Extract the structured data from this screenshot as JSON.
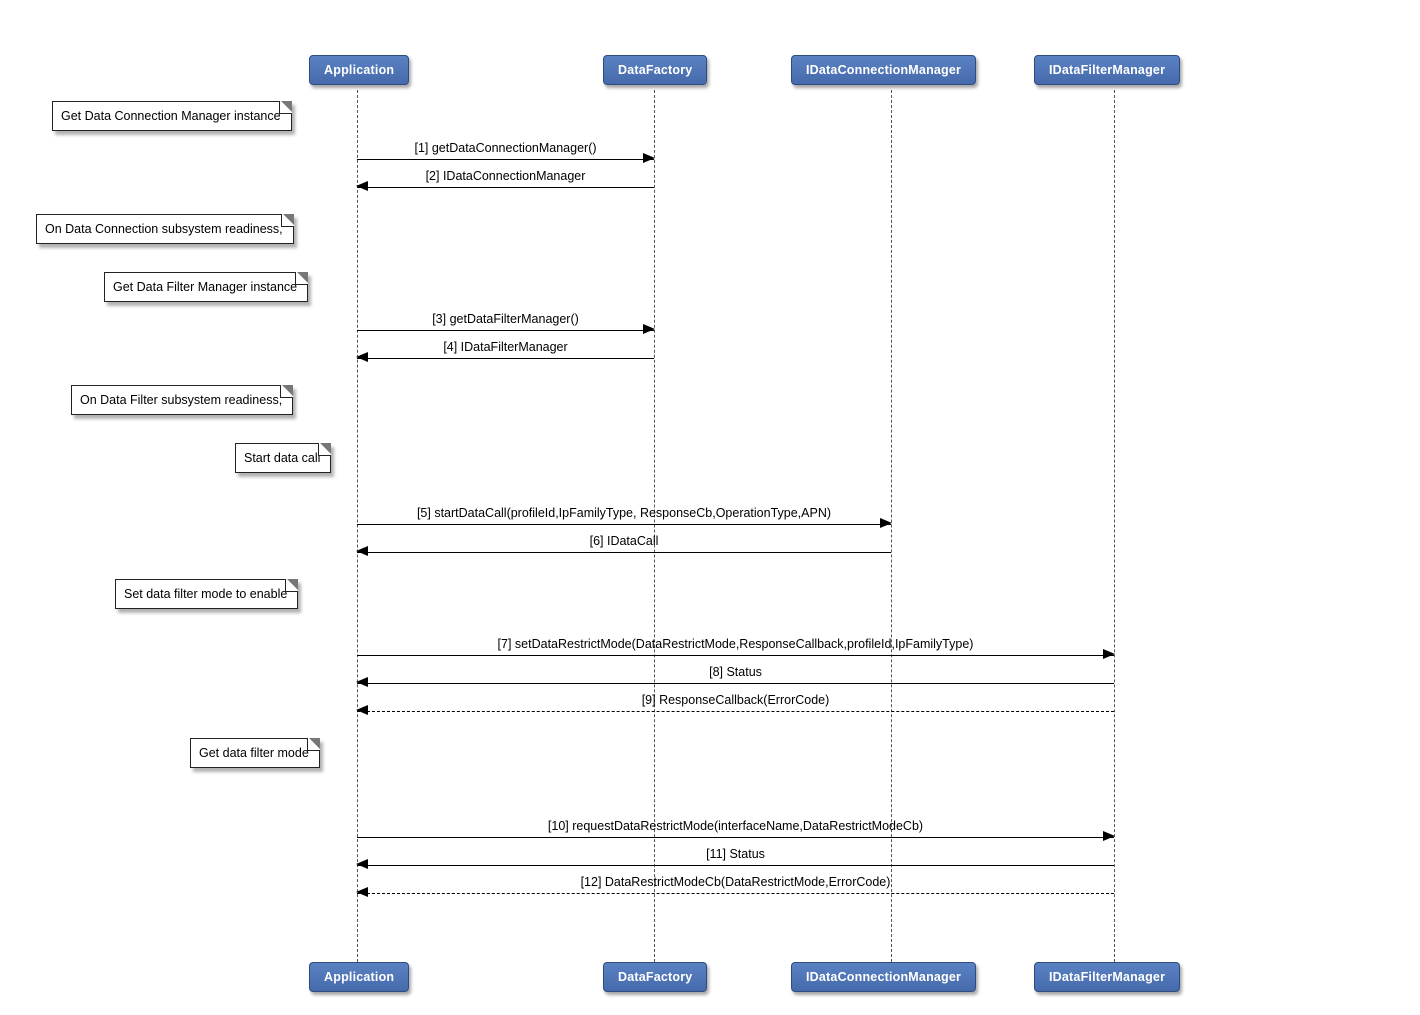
{
  "participants": {
    "application": "Application",
    "datafactory": "DataFactory",
    "idataconnectionmanager": "IDataConnectionManager",
    "idatafiltermanager": "IDataFilterManager"
  },
  "x": {
    "application": 357,
    "datafactory": 654,
    "idataconnectionmanager": 891,
    "idatafiltermanager": 1114
  },
  "notes": {
    "n1": "Get Data Connection Manager instance",
    "n2": "On Data Connection subsystem readiness,",
    "n3": "Get Data Filter Manager instance",
    "n4": "On Data Filter subsystem readiness,",
    "n5": "Start data call",
    "n6": "Set data filter mode to enable",
    "n7": "Get data filter mode"
  },
  "messages": {
    "m1": "[1] getDataConnectionManager()",
    "m2": "[2] IDataConnectionManager",
    "m3": "[3] getDataFilterManager()",
    "m4": "[4] IDataFilterManager",
    "m5": "[5] startDataCall(profileId,IpFamilyType, ResponseCb,OperationType,APN)",
    "m6": "[6] IDataCall",
    "m7": "[7] setDataRestrictMode(DataRestrictMode,ResponseCallback,profileId,IpFamilyType)",
    "m8": "[8] Status",
    "m9": "[9] ResponseCallback(ErrorCode)",
    "m10": "[10] requestDataRestrictMode(interfaceName,DataRestrictModeCb)",
    "m11": "[11] Status",
    "m12": "[12] DataRestrictModeCb(DataRestrictMode,ErrorCode)"
  }
}
